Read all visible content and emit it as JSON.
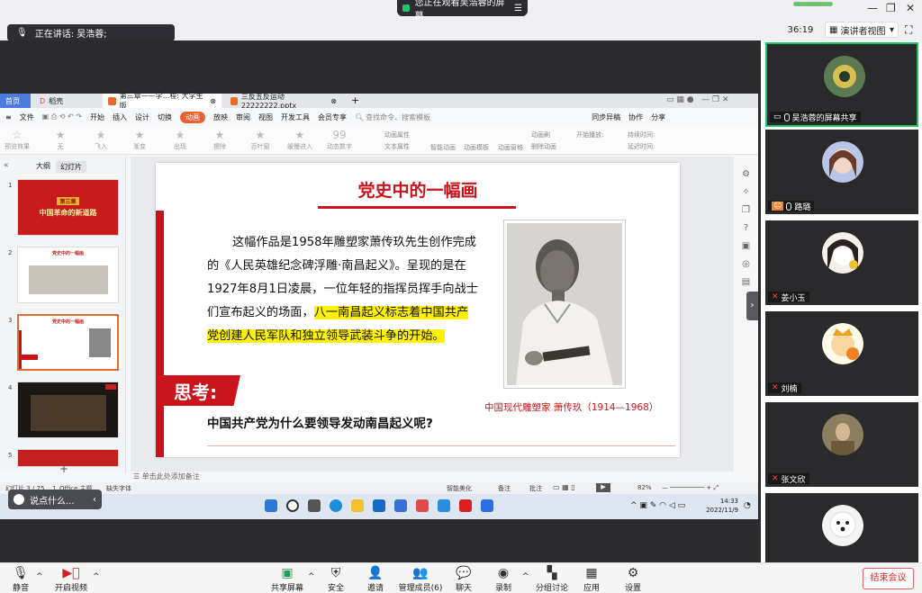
{
  "meeting": {
    "viewing_text": "您正在观看吴浩蓉的屏幕",
    "speaking_text": "正在讲话: 吴浩蓉;",
    "timer": "36:19",
    "presenter_view": "演讲者视图",
    "end_label": "结束会议"
  },
  "wps": {
    "tabs": [
      "首页",
      "稻壳",
      "第三章——学...程: 大学生版",
      "三反五反运动22222222.pptx"
    ],
    "menu": [
      "文件",
      "开始",
      "插入",
      "设计",
      "切换",
      "动画",
      "放映",
      "审阅",
      "视图",
      "开发工具",
      "会员专享"
    ],
    "active_menu": "动画",
    "search_placeholder": "查找命令、搜索模板",
    "menu_right": [
      "同步异稿",
      "协作",
      "分享"
    ],
    "ribbon_items": [
      "预览效果",
      "无",
      "飞入",
      "渐变",
      "出现",
      "擦除",
      "百叶窗",
      "缓慢进入",
      "动态数字"
    ],
    "ribbon_small": [
      "动画属性",
      "文本属性",
      "智能动画",
      "动画模板",
      "动画窗格",
      "动画刷",
      "删除动画",
      "开始播放:",
      "持续时间:",
      "延迟时间:"
    ],
    "panel_tabs": [
      "大纲",
      "幻灯片"
    ],
    "thumbs": [
      {
        "num": "1",
        "title": "第三章",
        "subtitle": "中国革命的新道路"
      },
      {
        "num": "2",
        "title": "党史中的一幅画"
      },
      {
        "num": "3",
        "title": "党史中的一幅画"
      },
      {
        "num": "4",
        "title": ""
      },
      {
        "num": "5",
        "title": ""
      }
    ],
    "notes_placeholder": "单击此处添加备注",
    "status": {
      "slide_count": "幻灯片 3 / 75",
      "theme": "1_Office 主题",
      "font_missing": "缺失字体",
      "beautify": "智能美化",
      "notes": "备注",
      "comments": "批注",
      "zoom": "82%"
    }
  },
  "slide": {
    "title": "党史中的一幅画",
    "body_plain": "这幅作品是1958年雕塑家萧传玖先生创作完成的《人民英雄纪念碑浮雕·南昌起义》。呈现的是在1927年8月1日凌晨，一位年轻的指挥员挥手向战士们宣布起义的场面，",
    "body_highlight": "八一南昌起义标志着中国共产党创建人民军队和独立领导武装斗争的开始。",
    "caption": "中国现代雕塑家 萧传玖（1914—1968）",
    "think_label": "思考:",
    "question": "中国共产党为什么要领导发动南昌起义呢?"
  },
  "taskbar": {
    "time": "14:33",
    "date": "2022/11/9",
    "say_label": "说点什么..."
  },
  "participants": [
    {
      "name": "吴浩蓉的屏幕共享",
      "active": true
    },
    {
      "name": "路璐"
    },
    {
      "name": "姜小玉"
    },
    {
      "name": "刘楠"
    },
    {
      "name": "张文欣"
    },
    {
      "name": ""
    }
  ],
  "toolbar": [
    {
      "label": "静音",
      "icon": "mic-icon"
    },
    {
      "label": "开启视频",
      "icon": "video-off-icon"
    },
    {
      "label": "共享屏幕",
      "icon": "share-screen-icon"
    },
    {
      "label": "安全",
      "icon": "shield-icon"
    },
    {
      "label": "邀请",
      "icon": "invite-icon"
    },
    {
      "label": "管理成员(6)",
      "icon": "members-icon"
    },
    {
      "label": "聊天",
      "icon": "chat-icon"
    },
    {
      "label": "录制",
      "icon": "record-icon"
    },
    {
      "label": "分组讨论",
      "icon": "breakout-icon"
    },
    {
      "label": "应用",
      "icon": "apps-icon"
    },
    {
      "label": "设置",
      "icon": "gear-icon"
    }
  ],
  "colors": {
    "accent_red": "#c8141a",
    "highlight": "#fff200",
    "active_green": "#22c35e",
    "wps_tab_blue": "#4d7be0"
  }
}
